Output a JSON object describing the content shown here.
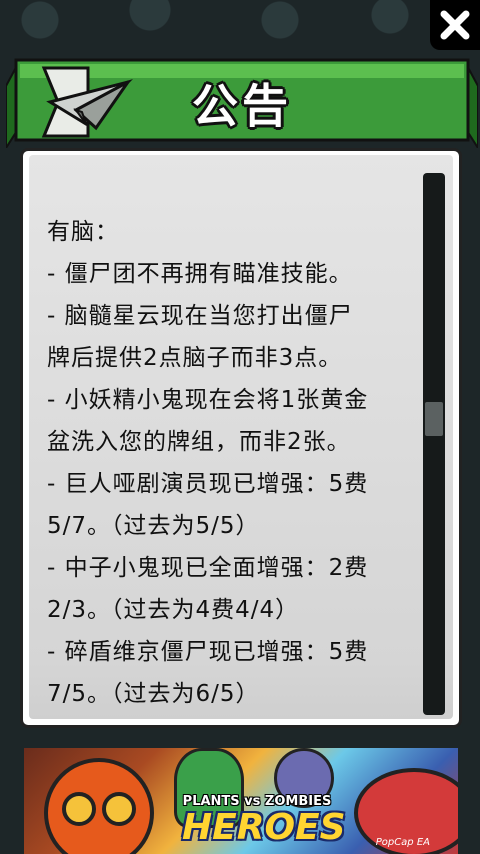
{
  "dialog": {
    "title": "公告",
    "close_icon": "close-icon",
    "header_icon": "paper-plane-icon",
    "ribbon_color": "#3c9b3a"
  },
  "announcement": {
    "lines": [
      "有脑：",
      "- 僵尸团不再拥有瞄准技能。",
      "- 脑髓星云现在当您打出僵尸",
      "牌后提供2点脑子而非3点。",
      "- 小妖精小鬼现在会将1张黄金",
      "盆洗入您的牌组，而非2张。",
      "- 巨人哑剧演员现已增强：5费",
      "5/7。（过去为5/5）",
      "- 中子小鬼现已全面增强：2费",
      "2/3。（过去为4费4/4）",
      "- 碎盾维京僵尸现已增强：5费",
      "7/5。（过去为6/5）"
    ]
  },
  "scroll": {
    "position": 0.45
  },
  "ad": {
    "brand_line": "PLANTS vs ZOMBIES",
    "title": "HEROES",
    "publisher": "PopCap EA"
  }
}
